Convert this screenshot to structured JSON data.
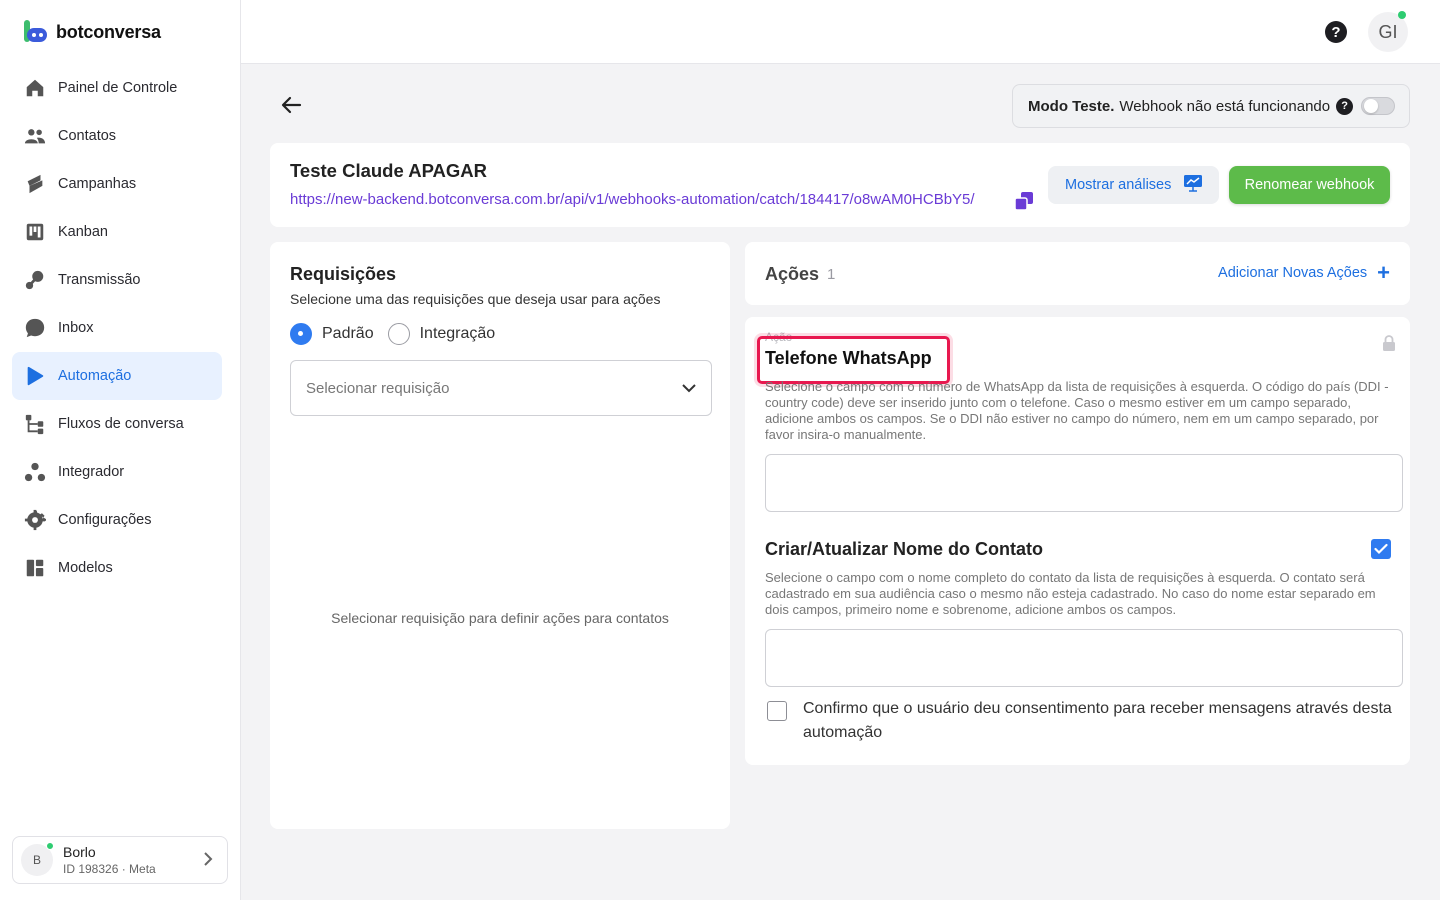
{
  "brand": {
    "name": "botconversa"
  },
  "sidebar": {
    "items": [
      {
        "label": "Painel de Controle",
        "icon": "home-icon"
      },
      {
        "label": "Contatos",
        "icon": "users-icon"
      },
      {
        "label": "Campanhas",
        "icon": "campaign-icon"
      },
      {
        "label": "Kanban",
        "icon": "kanban-icon"
      },
      {
        "label": "Transmissão",
        "icon": "broadcast-icon"
      },
      {
        "label": "Inbox",
        "icon": "chat-icon"
      },
      {
        "label": "Automação",
        "icon": "play-icon",
        "active": true
      },
      {
        "label": "Fluxos de conversa",
        "icon": "flow-icon"
      },
      {
        "label": "Integrador",
        "icon": "integrator-icon"
      },
      {
        "label": "Configurações",
        "icon": "gear-icon"
      },
      {
        "label": "Modelos",
        "icon": "templates-icon"
      }
    ],
    "account": {
      "initial": "B",
      "name": "Borlo",
      "id": "ID 198326 · Meta"
    }
  },
  "topbar": {
    "help": "?",
    "user_initials": "GI"
  },
  "mode": {
    "label": "Modo Teste.",
    "text": "Webhook não está funcionando",
    "enabled": false
  },
  "webhook": {
    "title": "Teste Claude APAGAR",
    "url": "https://new-backend.botconversa.com.br/api/v1/webhooks-automation/catch/184417/o8wAM0HCBbY5/",
    "analytics_label": "Mostrar análises",
    "rename_label": "Renomear webhook"
  },
  "requests": {
    "title": "Requisições",
    "subtitle": "Selecione uma das requisições que deseja usar para ações",
    "options": [
      "Padrão",
      "Integração"
    ],
    "selected": "Padrão",
    "select_placeholder": "Selecionar requisição",
    "empty_text": "Selecionar requisição para definir ações para contatos"
  },
  "actions": {
    "title": "Ações",
    "count": "1",
    "add_label": "Adicionar Novas Ações",
    "section_label": "Ação",
    "phone": {
      "title": "Telefone WhatsApp",
      "description": "Selecione o campo com o número de WhatsApp da lista de requisições à esquerda. O código do país (DDI - country code) deve ser inserido junto com o telefone. Caso o mesmo estiver em um campo separado, adicione ambos os campos. Se o DDI não estiver no campo do número, nem em um campo separado, por favor insira-o manualmente."
    },
    "name": {
      "title": "Criar/Atualizar Nome do Contato",
      "checked": true,
      "description": "Selecione o campo com o nome completo do contato da lista de requisições à esquerda. O contato será cadastrado em sua audiência caso o mesmo não esteja cadastrado. No caso do nome estar separado em dois campos, primeiro nome e sobrenome, adicione ambos os campos."
    },
    "consent": {
      "text": "Confirmo que o usuário deu consentimento para receber mensagens através desta automação",
      "checked": false
    }
  },
  "colors": {
    "accent": "#1d6fe0",
    "green": "#5dbb4a",
    "highlight": "#e8184f",
    "url": "#6a3bd6"
  }
}
